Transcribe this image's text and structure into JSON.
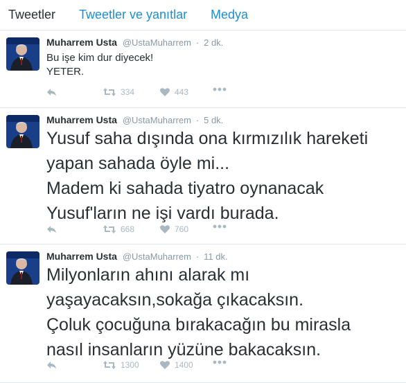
{
  "tabs": [
    {
      "label": "Tweetler",
      "active": true
    },
    {
      "label": "Tweetler ve yanıtlar",
      "active": false
    },
    {
      "label": "Medya",
      "active": false
    }
  ],
  "colors": {
    "link": "#1d8ed6",
    "muted": "#8899a6",
    "icon": "#aab8c2",
    "background": "#f5f8fa"
  },
  "tweets": [
    {
      "name": "Muharrem Usta",
      "handle": "@UstaMuharrem",
      "separator": "·",
      "time": "2 dk.",
      "text": "Bu işe kim dur diyecek!\nYETER.",
      "retweets": "334",
      "likes": "443"
    },
    {
      "name": "Muharrem Usta",
      "handle": "@UstaMuharrem",
      "separator": "·",
      "time": "5 dk.",
      "text": "Yusuf saha dışında ona kırmızılık hareketi\nyapan sahada öyle mi...\nMadem ki sahada tiyatro oynanacak\nYusuf'ların ne işi vardı burada.",
      "retweets": "668",
      "likes": "760"
    },
    {
      "name": "Muharrem Usta",
      "handle": "@UstaMuharrem",
      "separator": "·",
      "time": "11 dk.",
      "text": "Milyonların ahını alarak mı\nyaşayacaksın,sokağa çıkacaksın.\nÇoluk çocuğuna  bırakacağın bu mirasla\nnasıl insanların yüzüne bakacaksın.",
      "retweets": "1300",
      "likes": "1400"
    }
  ],
  "icons": {
    "reply": "reply-icon",
    "retweet": "retweet-icon",
    "like": "heart-icon",
    "more": "more-dots-icon"
  }
}
